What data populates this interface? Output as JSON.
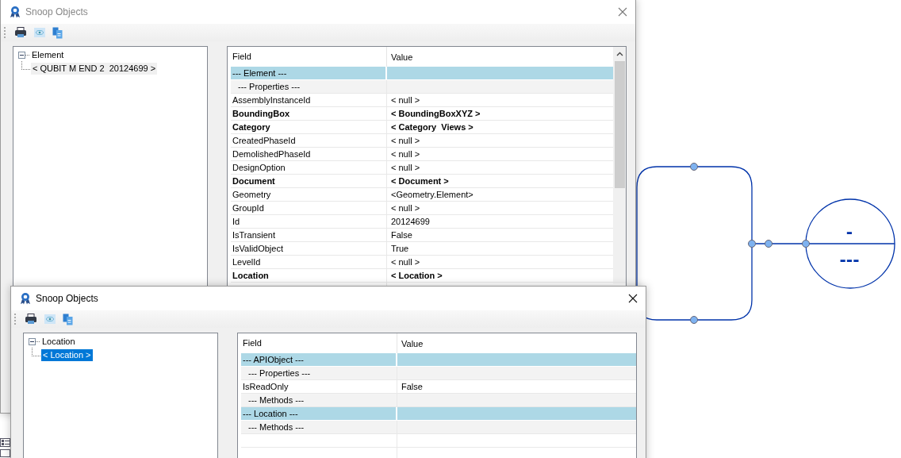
{
  "canvas": {
    "tag_labels": [
      "-",
      "---"
    ]
  },
  "windows": [
    {
      "title": "Snoop Objects",
      "active": false,
      "tree": [
        {
          "label": "Element",
          "expanded": true,
          "selected": false,
          "children": [
            {
              "label": "< QUBIT M END 2  20124699 >",
              "selected": true
            }
          ]
        }
      ],
      "columns": [
        "Field",
        "Value"
      ],
      "rows": [
        {
          "kind": "header",
          "field": "--- Element ---"
        },
        {
          "kind": "section",
          "field": "--- Properties ---"
        },
        {
          "kind": "property",
          "field": "AssemblyInstanceId",
          "value": "< null >",
          "bold": false
        },
        {
          "kind": "property",
          "field": "BoundingBox",
          "value": "< BoundingBoxXYZ >",
          "bold": true
        },
        {
          "kind": "property",
          "field": "Category",
          "value": "< Category  Views >",
          "bold": true
        },
        {
          "kind": "property",
          "field": "CreatedPhaseId",
          "value": "< null >",
          "bold": false
        },
        {
          "kind": "property",
          "field": "DemolishedPhaseId",
          "value": "< null >",
          "bold": false
        },
        {
          "kind": "property",
          "field": "DesignOption",
          "value": "< null >",
          "bold": false
        },
        {
          "kind": "property",
          "field": "Document",
          "value": "< Document >",
          "bold": true
        },
        {
          "kind": "property",
          "field": "Geometry",
          "value": "<Geometry.Element>",
          "bold": false
        },
        {
          "kind": "property",
          "field": "GroupId",
          "value": "< null >",
          "bold": false
        },
        {
          "kind": "property",
          "field": "Id",
          "value": "20124699",
          "bold": false
        },
        {
          "kind": "property",
          "field": "IsTransient",
          "value": "False",
          "bold": false
        },
        {
          "kind": "property",
          "field": "IsValidObject",
          "value": "True",
          "bold": false
        },
        {
          "kind": "property",
          "field": "LevelId",
          "value": "< null >",
          "bold": false
        },
        {
          "kind": "property",
          "field": "Location",
          "value": "< Location >",
          "bold": true
        }
      ]
    },
    {
      "title": "Snoop Objects",
      "active": true,
      "tree": [
        {
          "label": "Location",
          "expanded": true,
          "selected": false,
          "children": [
            {
              "label": "< Location >",
              "selected": true
            }
          ]
        }
      ],
      "columns": [
        "Field",
        "Value"
      ],
      "rows": [
        {
          "kind": "header",
          "field": "--- APIObject ---"
        },
        {
          "kind": "section",
          "field": "--- Properties ---"
        },
        {
          "kind": "property",
          "field": "IsReadOnly",
          "value": "False",
          "bold": false
        },
        {
          "kind": "section",
          "field": "--- Methods ---"
        },
        {
          "kind": "header",
          "field": "--- Location ---"
        },
        {
          "kind": "section",
          "field": "--- Methods ---"
        }
      ]
    }
  ]
}
